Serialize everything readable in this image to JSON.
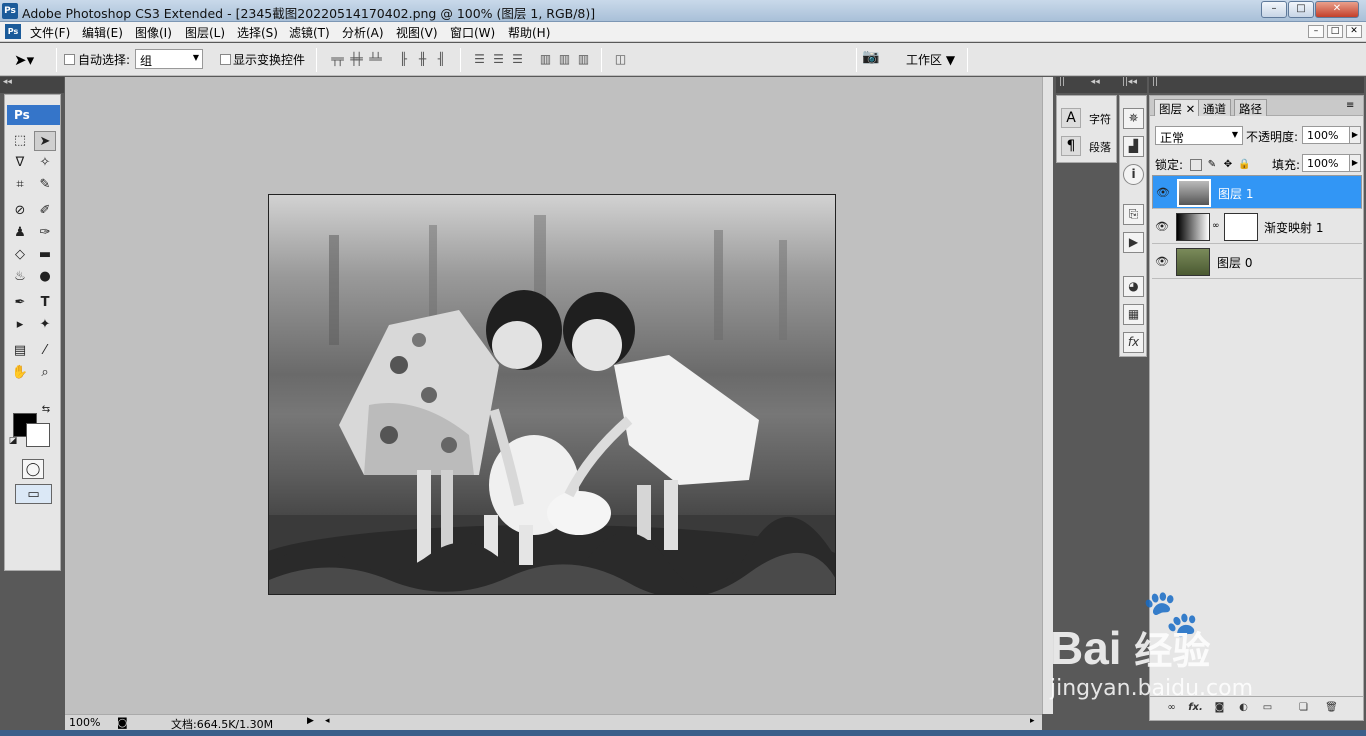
{
  "window": {
    "title": "Adobe Photoshop CS3 Extended - [2345截图20220514170402.png @ 100% (图层 1, RGB/8)]",
    "app_icon": "Ps",
    "min": "–",
    "max": "□",
    "close": "✕"
  },
  "menu": [
    "文件(F)",
    "编辑(E)",
    "图像(I)",
    "图层(L)",
    "选择(S)",
    "滤镜(T)",
    "分析(A)",
    "视图(V)",
    "窗口(W)",
    "帮助(H)"
  ],
  "options": {
    "auto_select_label": "自动选择:",
    "auto_select_value": "组",
    "show_transform_label": "显示变换控件",
    "workspace": "工作区"
  },
  "toolbox": {
    "logo": "Ps"
  },
  "document": {
    "zoom": "100%",
    "doc_size": "文档:664.5K/1.30M"
  },
  "char_panel": [
    {
      "icon": "A",
      "label": "字符"
    },
    {
      "icon": "¶",
      "label": "段落"
    }
  ],
  "layers_panel": {
    "tabs": [
      "图层",
      "通道",
      "路径"
    ],
    "blend_mode": "正常",
    "opacity_label": "不透明度:",
    "opacity": "100%",
    "lock_label": "锁定:",
    "fill_label": "填充:",
    "fill": "100%",
    "layers": [
      {
        "name": "图层 1",
        "selected": true
      },
      {
        "name": "渐变映射 1",
        "selected": false
      },
      {
        "name": "图层 0",
        "selected": false
      }
    ],
    "footer_fx": "fx."
  },
  "watermark": {
    "brand": "Bai",
    "brand2": "经验",
    "url": "jingyan.baidu.com"
  }
}
